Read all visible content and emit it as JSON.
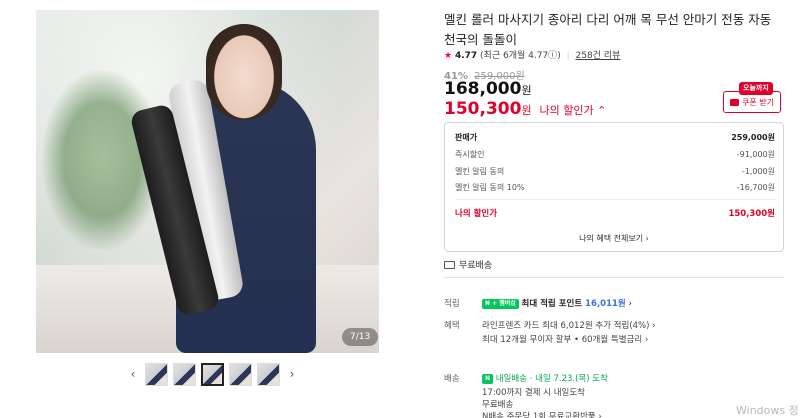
{
  "gallery": {
    "counter": "7/13",
    "prev_icon": "‹",
    "next_icon": "›",
    "thumb_count": 5,
    "selected_thumb": 3
  },
  "product": {
    "title": "멜킨 롤러 마사지기 종아리 다리 어깨 목 무선 안마기 전동 자동 천국의 돌돌이",
    "rating_star": "★",
    "rating": "4.77",
    "rating_recent": "(최근 6개월 4.77",
    "rating_info_icon": "ⓘ",
    "rating_recent_close": ")",
    "review_count": "258건 리뷰",
    "discount_pct": "41%",
    "original_price": "259,000원",
    "price": "168,000",
    "price_unit": "원",
    "my_price": "150,300",
    "my_price_unit": "원",
    "my_price_label": "나의 할인가 ⌃"
  },
  "coupon": {
    "today_badge": "오늘까지",
    "label": "쿠폰 받기"
  },
  "breakdown": {
    "rows": [
      {
        "label": "판매가",
        "value": "259,000원"
      },
      {
        "label": "즉시할인",
        "value": "-91,000원"
      },
      {
        "label": "멜킨 알림 동의",
        "value": "-1,000원"
      },
      {
        "label": "멜킨 알림 동의 10%",
        "value": "-16,700원"
      }
    ],
    "total_label": "나의 할인가",
    "total_value": "150,300원",
    "more_link": "나의 혜택 전체보기 ›"
  },
  "shipping_badge": "무료배송",
  "points": {
    "label": "적립",
    "npay_badge": "N + 멤버십",
    "text": "최대 적립 포인트 ",
    "value": "16,011원",
    "arrow": "›"
  },
  "benefits": {
    "label": "혜택",
    "line1": "라인프렌즈 카드 최대 6,012원 추가 적립(4%) ›",
    "line2": "최대 12개월 무이자 할부 • 60개월 특별금리 ›"
  },
  "delivery": {
    "label": "배송",
    "badge": "N",
    "today_text": "내일배송",
    "eta": " · 내일 7.23.(목) 도착",
    "line2": "17:00까지 결제 시 내일도착",
    "line3": "무료배송",
    "line4": "N배송 주문당 1회 무료교환반품 ›"
  },
  "watermark": "Windows 정"
}
